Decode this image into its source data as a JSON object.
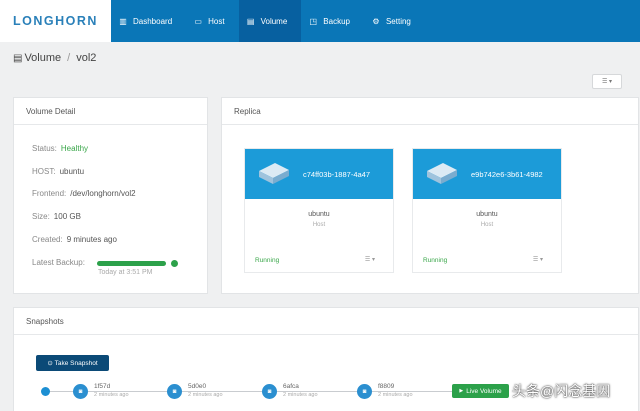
{
  "app": {
    "logo_text": "LONGHORN"
  },
  "nav": {
    "items": [
      {
        "label": "Dashboard",
        "icon": "dashboard-icon"
      },
      {
        "label": "Host",
        "icon": "host-icon"
      },
      {
        "label": "Volume",
        "icon": "volume-icon",
        "active": true
      },
      {
        "label": "Backup",
        "icon": "backup-icon"
      },
      {
        "label": "Setting",
        "icon": "setting-icon"
      }
    ]
  },
  "breadcrumb": {
    "section": "Volume",
    "separator": "/",
    "current": "vol2"
  },
  "volume_detail": {
    "title": "Volume Detail",
    "status_label": "Status:",
    "status_value": "Healthy",
    "host_label": "HOST:",
    "host_value": "ubuntu",
    "frontend_label": "Frontend:",
    "frontend_value": "/dev/longhorn/vol2",
    "size_label": "Size:",
    "size_value": "100 GB",
    "created_label": "Created:",
    "created_value": "9 minutes ago",
    "backup_label": "Latest Backup:",
    "backup_time": "Today at 3:51 PM",
    "backup_progress": 1.0
  },
  "replica": {
    "title": "Replica",
    "cards": [
      {
        "name": "c74ff03b-1887-4a47",
        "host": "ubuntu",
        "role": "Host",
        "status": "Running"
      },
      {
        "name": "e9b742e6-3b61-4982",
        "host": "ubuntu",
        "role": "Host",
        "status": "Running"
      }
    ]
  },
  "snapshots": {
    "title": "Snapshots",
    "take_label": "Take Snapshot",
    "items": [
      {
        "id": "1f57d",
        "time": "2 minutes ago"
      },
      {
        "id": "5d0e0",
        "time": "2 minutes ago"
      },
      {
        "id": "6afca",
        "time": "2 minutes ago"
      },
      {
        "id": "f8809",
        "time": "2 minutes ago"
      }
    ],
    "live_label": "Live Volume"
  },
  "watermark": "头条@闪念基因",
  "colors": {
    "nav_bg": "#0a76b7",
    "nav_active": "#0760a0",
    "accent": "#1c9bd8",
    "healthy": "#3aa74a",
    "button_dark": "#0b4a77"
  }
}
